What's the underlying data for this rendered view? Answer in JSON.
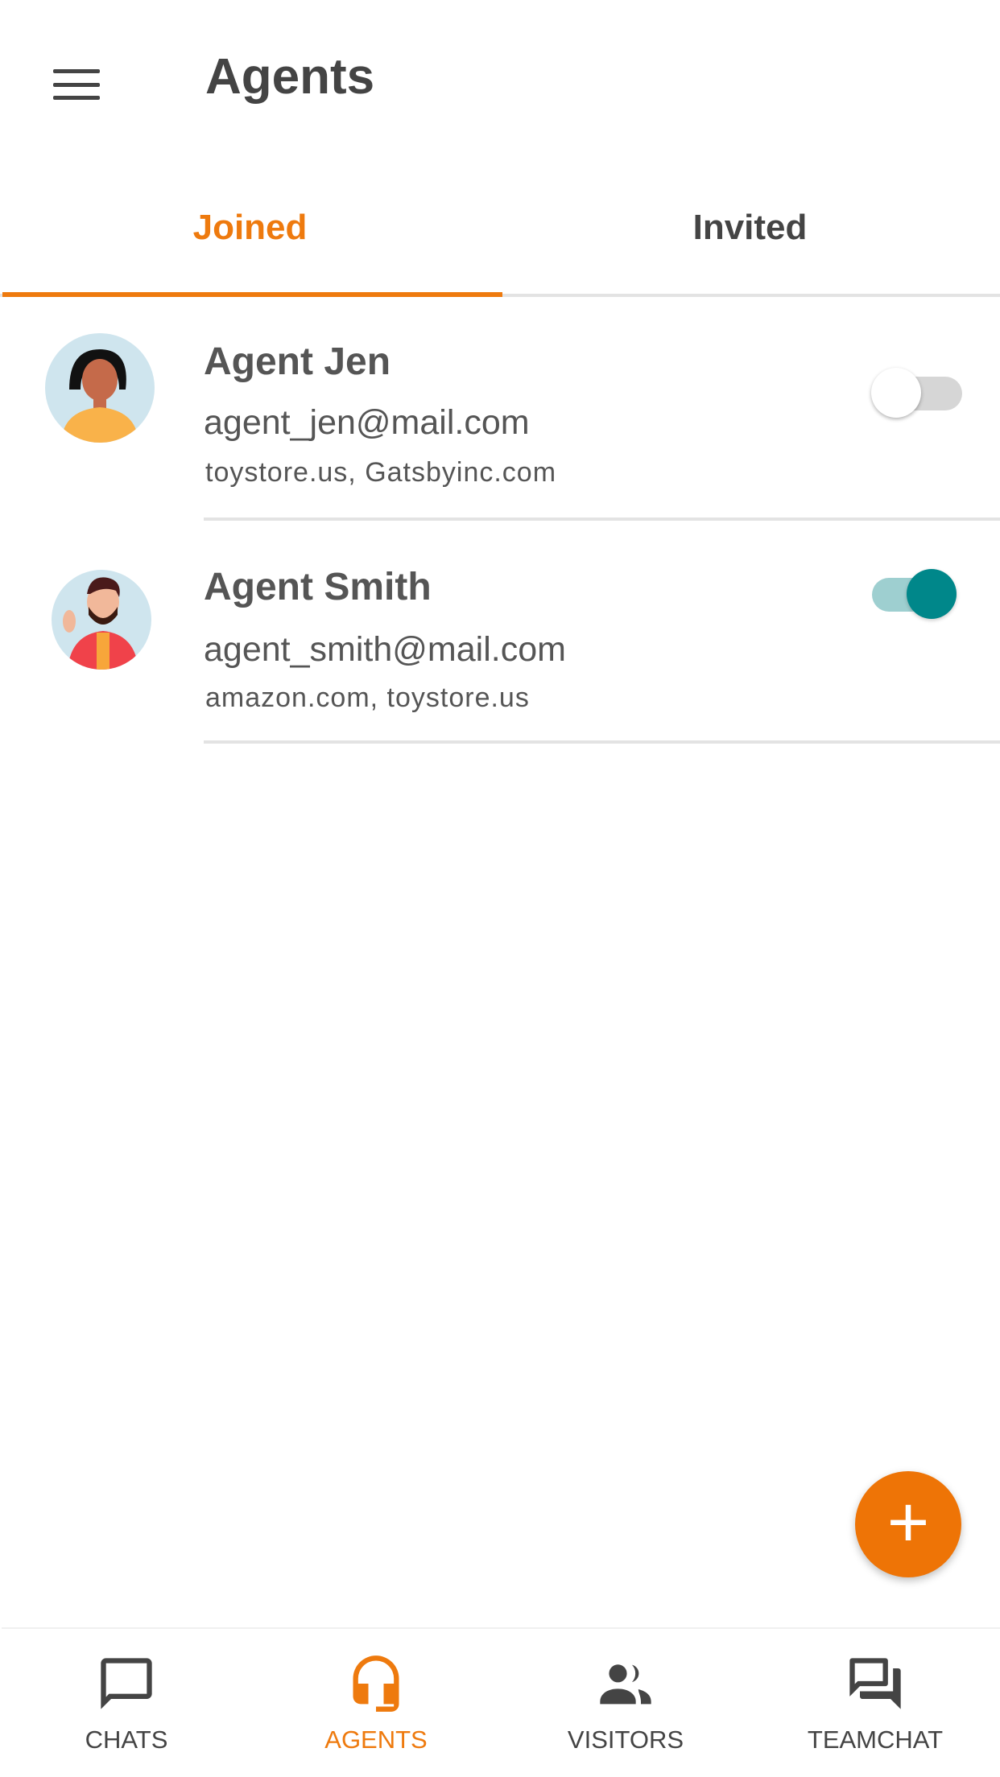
{
  "header": {
    "title": "Agents",
    "menu_icon": "hamburger-icon"
  },
  "tabs": [
    {
      "label": "Joined",
      "active": true
    },
    {
      "label": "Invited",
      "active": false
    }
  ],
  "agents": [
    {
      "name": "Agent Jen",
      "email": "agent_jen@mail.com",
      "domains": "toystore.us, Gatsbyinc.com",
      "enabled": false
    },
    {
      "name": "Agent Smith",
      "email": "agent_smith@mail.com",
      "domains": "amazon.com, toystore.us",
      "enabled": true
    }
  ],
  "fab": {
    "label": "+",
    "icon": "plus-icon"
  },
  "nav": [
    {
      "label": "CHATS",
      "icon": "chat-bubble-icon"
    },
    {
      "label": "AGENTS",
      "icon": "headset-icon",
      "active": true
    },
    {
      "label": "VISITORS",
      "icon": "people-icon"
    },
    {
      "label": "TEAMCHAT",
      "icon": "forum-icon"
    }
  ],
  "colors": {
    "accent": "#EE7A0E",
    "toggle_on": "#00878A",
    "toggle_on_track": "#9ECFD0",
    "toggle_off_track": "#D6D6D6"
  }
}
